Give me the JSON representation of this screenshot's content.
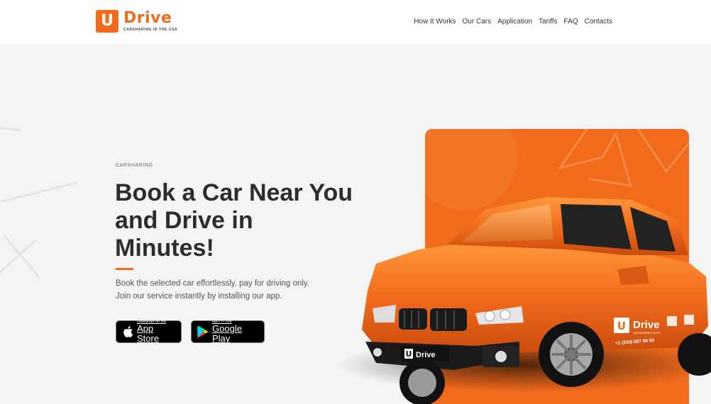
{
  "brand": {
    "logo_letter": "U",
    "name": "Drive",
    "tagline": "CARSHARING IN THE USA",
    "color": "#f26b1d"
  },
  "nav": {
    "items": [
      "How It Works",
      "Our Cars",
      "Application",
      "Tariffs",
      "FAQ",
      "Contacts"
    ]
  },
  "hero": {
    "eyebrow": "CARSHARING",
    "title_lines": [
      "Book a Car Near You",
      "and Drive in",
      "Minutes!"
    ],
    "description_lines": [
      "Book the selected car effortlessly, pay for driving only.",
      "Join our service instantly by installing our app."
    ],
    "app_store": {
      "small": "Download on the",
      "big": "App Store",
      "icon": "apple-icon"
    },
    "google_play": {
      "small": "GET IT ON",
      "big": "Google Play",
      "icon": "google-play-icon"
    }
  },
  "car_decal": {
    "plate_brand": "Drive",
    "plate_letter": "U",
    "side_brand": "Drive",
    "side_tagline": "CARSHARING IN NY",
    "phone": "+1 (234) 567 89 00"
  }
}
